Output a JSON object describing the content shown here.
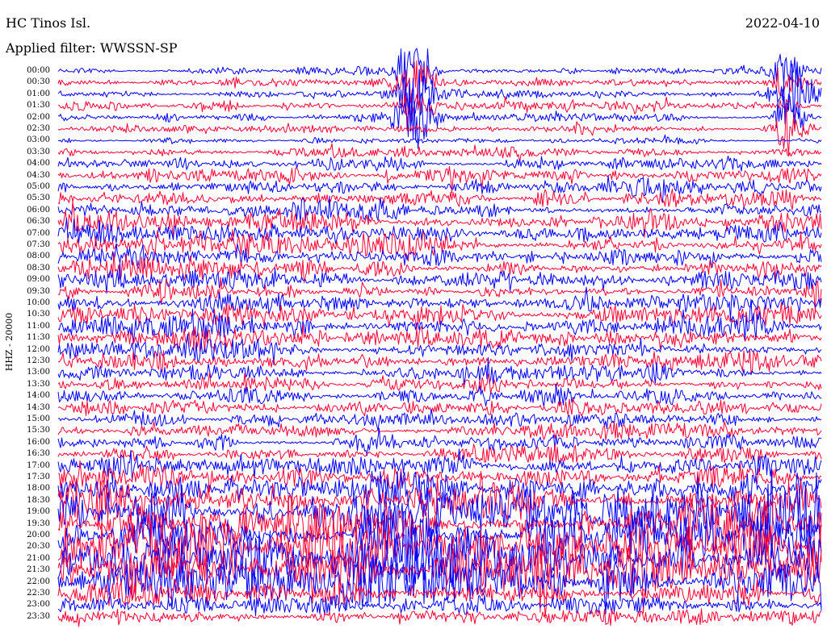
{
  "header": {
    "station": "HC Tinos Isl.",
    "date": "2022-04-10",
    "filter": "Applied filter: WWSSN-SP"
  },
  "chart_data": {
    "type": "line",
    "subtype": "helicorder",
    "ylabel": "HHZ - 20000",
    "row_labels": [
      "00:00",
      "00:30",
      "01:00",
      "01:30",
      "02:00",
      "02:30",
      "03:00",
      "03:30",
      "04:00",
      "04:30",
      "05:00",
      "05:30",
      "06:00",
      "06:30",
      "07:00",
      "07:30",
      "08:00",
      "08:30",
      "09:00",
      "09:30",
      "10:00",
      "10:30",
      "11:00",
      "11:30",
      "12:00",
      "12:30",
      "13:00",
      "13:30",
      "14:00",
      "14:30",
      "15:00",
      "15:30",
      "16:00",
      "16:30",
      "17:00",
      "17:30",
      "18:00",
      "18:30",
      "19:00",
      "19:30",
      "20:00",
      "20:30",
      "21:00",
      "21:30",
      "22:00",
      "22:30",
      "23:00",
      "23:30"
    ],
    "row_minutes": 30,
    "trace_colors": [
      "#0000ff",
      "#ff0033"
    ],
    "row_amplitude": [
      0.35,
      0.4,
      0.45,
      0.5,
      0.45,
      0.4,
      0.35,
      0.5,
      0.6,
      0.75,
      0.85,
      0.95,
      1.0,
      1.0,
      1.05,
      1.1,
      1.1,
      1.05,
      1.0,
      0.95,
      0.9,
      1.0,
      1.0,
      0.95,
      0.9,
      0.85,
      0.85,
      0.8,
      0.9,
      0.85,
      0.75,
      0.7,
      0.75,
      0.8,
      0.9,
      1.2,
      1.6,
      1.9,
      2.3,
      2.6,
      2.8,
      2.9,
      2.8,
      2.6,
      2.2,
      1.2,
      0.8,
      0.9
    ],
    "events": [
      {
        "row_start": "00:00",
        "row_end": "02:00",
        "minute": 14,
        "amplitude": 3.5
      },
      {
        "row_start": "00:00",
        "row_end": "02:30",
        "minute": 28.7,
        "amplitude": 3.0
      }
    ]
  }
}
